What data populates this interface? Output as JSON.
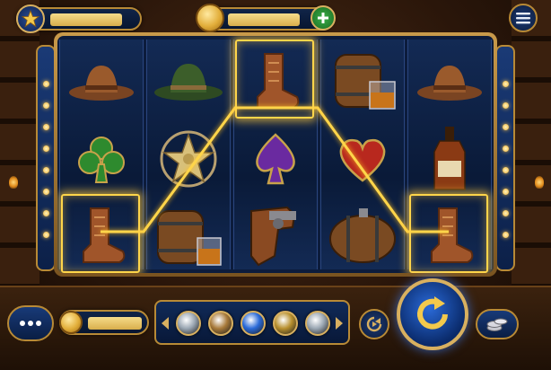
{
  "header": {
    "star_icon": "star-icon",
    "coin_icon": "coin-icon",
    "add_icon": "plus-icon",
    "menu_icon": "hamburger-menu-icon"
  },
  "reels": {
    "columns": [
      [
        "cowboy-hat-brown",
        "club-green",
        "cowboy-boot"
      ],
      [
        "cowboy-hat-green",
        "sheriff-star",
        "barrel-and-whiskey-glass"
      ],
      [
        "cowboy-boot",
        "spade-purple",
        "revolver-holster"
      ],
      [
        "barrel-and-whiskey-glass",
        "heart-red",
        "keg-barrel"
      ],
      [
        "cowboy-hat-brown",
        "whiskey-bottle",
        "cowboy-boot"
      ]
    ],
    "winning_cells": [
      [
        0,
        2
      ],
      [
        2,
        0
      ],
      [
        4,
        2
      ]
    ]
  },
  "bottom": {
    "more_icon": "ellipsis-icon",
    "coin_icon": "coin-icon",
    "chips": [
      {
        "name": "chip-silver",
        "color": "#9aa6b2"
      },
      {
        "name": "chip-bronze",
        "color": "#a87a3a"
      },
      {
        "name": "chip-blue",
        "color": "#2a6ad8"
      },
      {
        "name": "chip-gold",
        "color": "#b8902e"
      },
      {
        "name": "chip-silver",
        "color": "#9aa6b2"
      }
    ],
    "autoplay_icon": "autoplay-icon",
    "spin_icon": "spin-arrow-icon",
    "coins_stack_icon": "coin-stack-icon"
  },
  "colors": {
    "accent_gold": "#ffd54a",
    "panel_blue": "#0c1c3c",
    "wood": "#2a160a"
  }
}
